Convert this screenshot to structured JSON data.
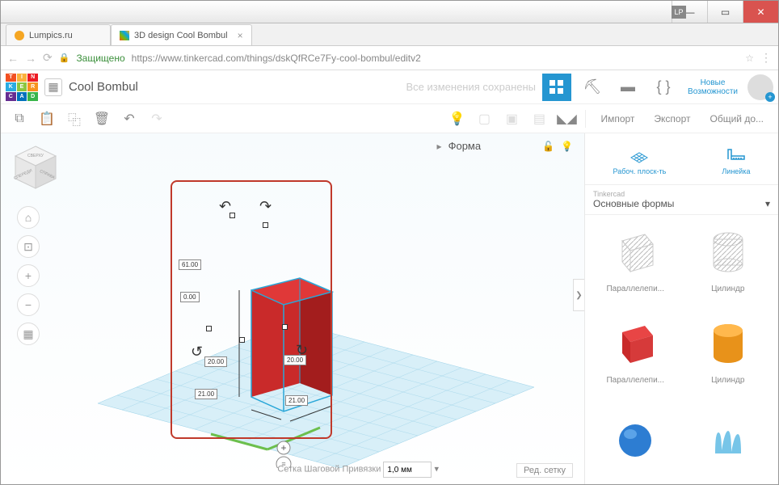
{
  "window": {
    "lp": "LP"
  },
  "tabs": [
    {
      "title": "Lumpics.ru"
    },
    {
      "title": "3D design Cool Bombul"
    }
  ],
  "urlbar": {
    "secure": "Защищено",
    "domain": "https://www.tinkercad.com",
    "path": "/things/dskQfRCe7Fy-cool-bombul/editv2"
  },
  "header": {
    "project": "Cool Bombul",
    "save_status": "Все изменения сохранены",
    "new_features_1": "Новые",
    "new_features_2": "Возможности"
  },
  "toolbar": {
    "import": "Импорт",
    "export": "Экспорт",
    "share": "Общий до..."
  },
  "shape_panel": {
    "label": "Форма"
  },
  "grid": {
    "edit": "Ред. сетку",
    "snap_label": "Сетка Шаговой Привязки",
    "snap_value": "1,0 мм"
  },
  "sidebar": {
    "workplane": "Рабоч. плоск-ть",
    "ruler": "Линейка",
    "category_small": "Tinkercad",
    "category": "Основные формы",
    "shapes": [
      {
        "name": "Параллелепи..."
      },
      {
        "name": "Цилиндр"
      },
      {
        "name": "Параллелепи..."
      },
      {
        "name": "Цилиндр"
      }
    ]
  },
  "viewcube": {
    "top": "СВЕРХУ",
    "front": "СПЕРЕДИ",
    "right": "СПРАВА"
  },
  "dimensions": {
    "height": "61.00",
    "zero": "0.00",
    "width1": "20.00",
    "width2": "20.00",
    "off1": "21.00",
    "off2": "21.00"
  }
}
